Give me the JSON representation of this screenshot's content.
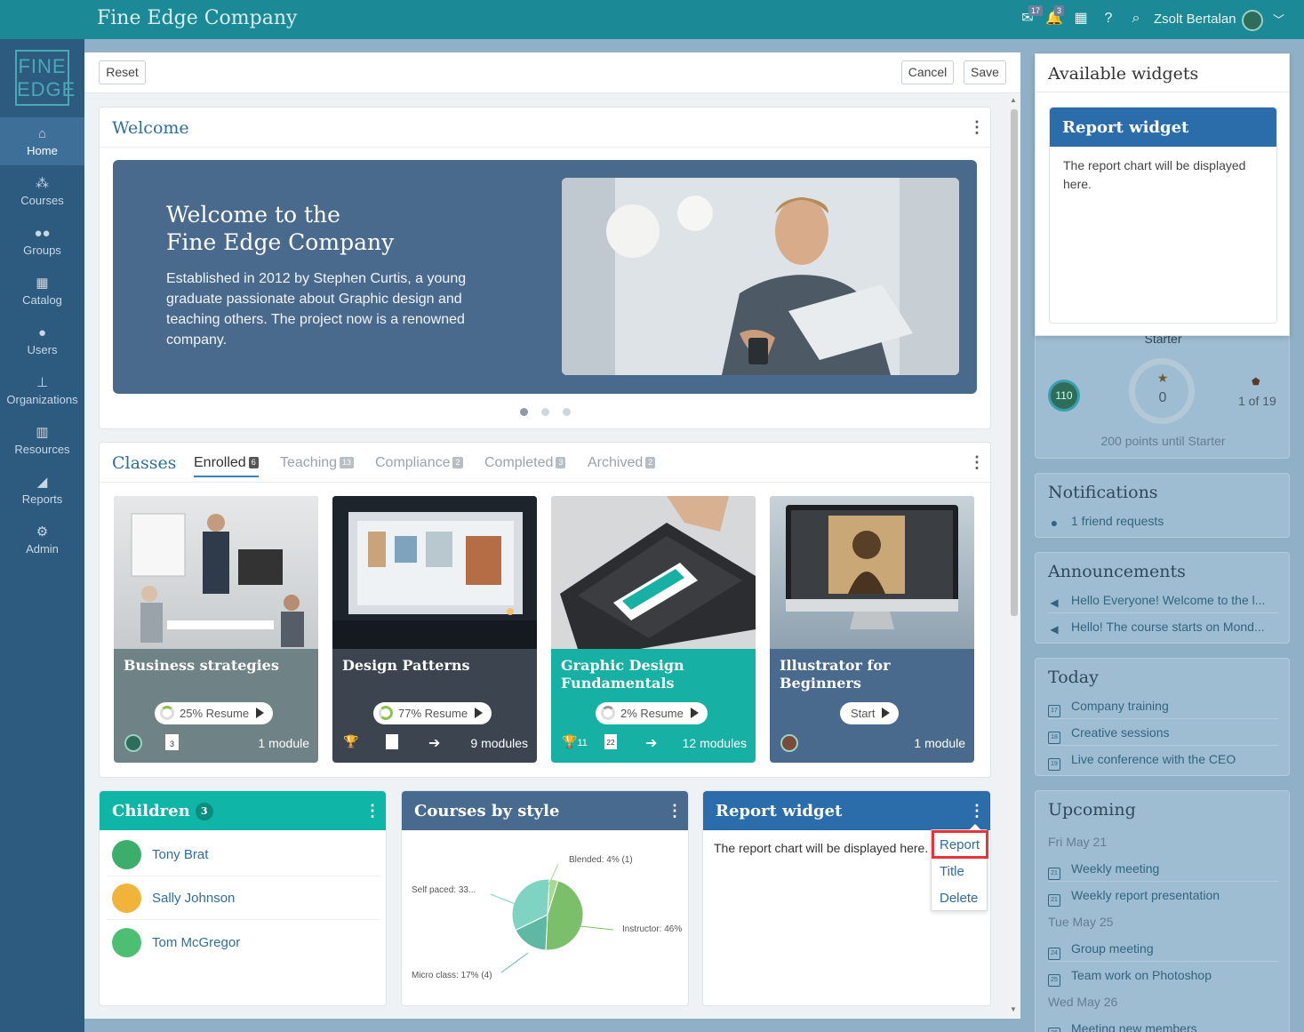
{
  "topbar": {
    "app_title": "Fine Edge Company",
    "messages_badge": "17",
    "notifications_badge": "3",
    "user_name": "Zsolt Bertalan"
  },
  "sidebar": {
    "logo_line1": "FINE",
    "logo_line2": "EDGE",
    "items": [
      {
        "label": "Home",
        "icon": "home-icon"
      },
      {
        "label": "Courses",
        "icon": "courses-icon"
      },
      {
        "label": "Groups",
        "icon": "groups-icon"
      },
      {
        "label": "Catalog",
        "icon": "catalog-icon"
      },
      {
        "label": "Users",
        "icon": "users-icon"
      },
      {
        "label": "Organizations",
        "icon": "organizations-icon"
      },
      {
        "label": "Resources",
        "icon": "resources-icon"
      },
      {
        "label": "Reports",
        "icon": "reports-icon"
      },
      {
        "label": "Admin",
        "icon": "gear-icon"
      }
    ]
  },
  "toolbar": {
    "reset_label": "Reset",
    "cancel_label": "Cancel",
    "save_label": "Save"
  },
  "welcome": {
    "header": "Welcome",
    "banner_title_line1": "Welcome to the",
    "banner_title_line2": "Fine Edge Company",
    "banner_text": "Established in 2012 by Stephen Curtis, a young graduate passionate about Graphic design and teaching others. The project now is a renowned company.",
    "slide_count": 3,
    "active_slide": 1
  },
  "classes": {
    "header": "Classes",
    "tabs": [
      {
        "label": "Enrolled",
        "count": "6"
      },
      {
        "label": "Teaching",
        "count": "13"
      },
      {
        "label": "Compliance",
        "count": "2"
      },
      {
        "label": "Completed",
        "count": "3"
      },
      {
        "label": "Archived",
        "count": "2"
      }
    ],
    "courses": [
      {
        "title": "Business strategies",
        "progress": "25%",
        "action": "Resume",
        "modules": "1 module",
        "doc_count": "3",
        "color": "#6f8285"
      },
      {
        "title": "Design Patterns",
        "progress": "77%",
        "action": "Resume",
        "modules": "9 modules",
        "color": "#3c4450"
      },
      {
        "title": "Graphic Design Fundamentals",
        "progress": "2%",
        "action": "Resume",
        "modules": "12 modules",
        "trophy_count": "11",
        "cal_day": "22",
        "color": "#17b0a4"
      },
      {
        "title": "Illustrator for Beginners",
        "progress": "",
        "action": "Start",
        "modules": "1 module",
        "color": "#4a6a8d"
      }
    ]
  },
  "children": {
    "title": "Children",
    "count": "3",
    "items": [
      {
        "name": "Tony Brat"
      },
      {
        "name": "Sally Johnson"
      },
      {
        "name": "Tom McGregor"
      }
    ]
  },
  "courses_by_style": {
    "title": "Courses by style",
    "labels": {
      "blended": "Blended: 4% (1)",
      "self_paced": "Self paced: 33...",
      "instructor": "Instructor: 46%",
      "micro": "Micro class: 17% (4)"
    }
  },
  "chart_data": {
    "type": "pie",
    "title": "Courses by style",
    "slices": [
      {
        "label": "Blended",
        "percent": 4,
        "count": 1,
        "color": "#a9d98f"
      },
      {
        "label": "Instructor",
        "percent": 46,
        "color": "#7bbf6a"
      },
      {
        "label": "Micro class",
        "percent": 17,
        "count": 4,
        "color": "#5fb8a3"
      },
      {
        "label": "Self paced",
        "percent": 33,
        "color": "#7fd3c3"
      }
    ]
  },
  "report_widget": {
    "title": "Report widget",
    "body": "The report chart will be displayed here.",
    "menu": [
      "Report",
      "Title",
      "Delete"
    ]
  },
  "available_widgets": {
    "title": "Available widgets",
    "widget_title": "Report widget",
    "widget_body": "The report chart will be displayed here."
  },
  "level": {
    "label": "Starter",
    "points": "110",
    "stars": "0",
    "rank": "1 of 19",
    "until": "200 points until Starter"
  },
  "notifications": {
    "title": "Notifications",
    "items": [
      "1 friend requests"
    ]
  },
  "announcements": {
    "title": "Announcements",
    "items": [
      "Hello Everyone! Welcome to the l...",
      "Hello! The course starts on Mond..."
    ]
  },
  "today": {
    "title": "Today",
    "items": [
      {
        "label": "Company training",
        "day": "17"
      },
      {
        "label": "Creative sessions",
        "day": "18"
      },
      {
        "label": "Live conference with the CEO",
        "day": "19"
      }
    ]
  },
  "upcoming": {
    "title": "Upcoming",
    "date1": "Fri May 21",
    "date2": "Tue May 25",
    "date3": "Wed May 26",
    "items": [
      {
        "label": "Weekly meeting",
        "day": "21"
      },
      {
        "label": "Weekly report presentation",
        "day": "21"
      },
      {
        "label": "Group meeting",
        "day": "24"
      },
      {
        "label": "Team work on Photoshop",
        "day": "25"
      },
      {
        "label": "Meeting new members",
        "day": "26"
      }
    ]
  },
  "colors": {
    "topbar": "#1c8a96",
    "sidebar": "#2d5b80",
    "children_header": "#0fb5a6",
    "style_header": "#486a8e",
    "report_header": "#2b6cab",
    "highlight": "#e8333a"
  }
}
